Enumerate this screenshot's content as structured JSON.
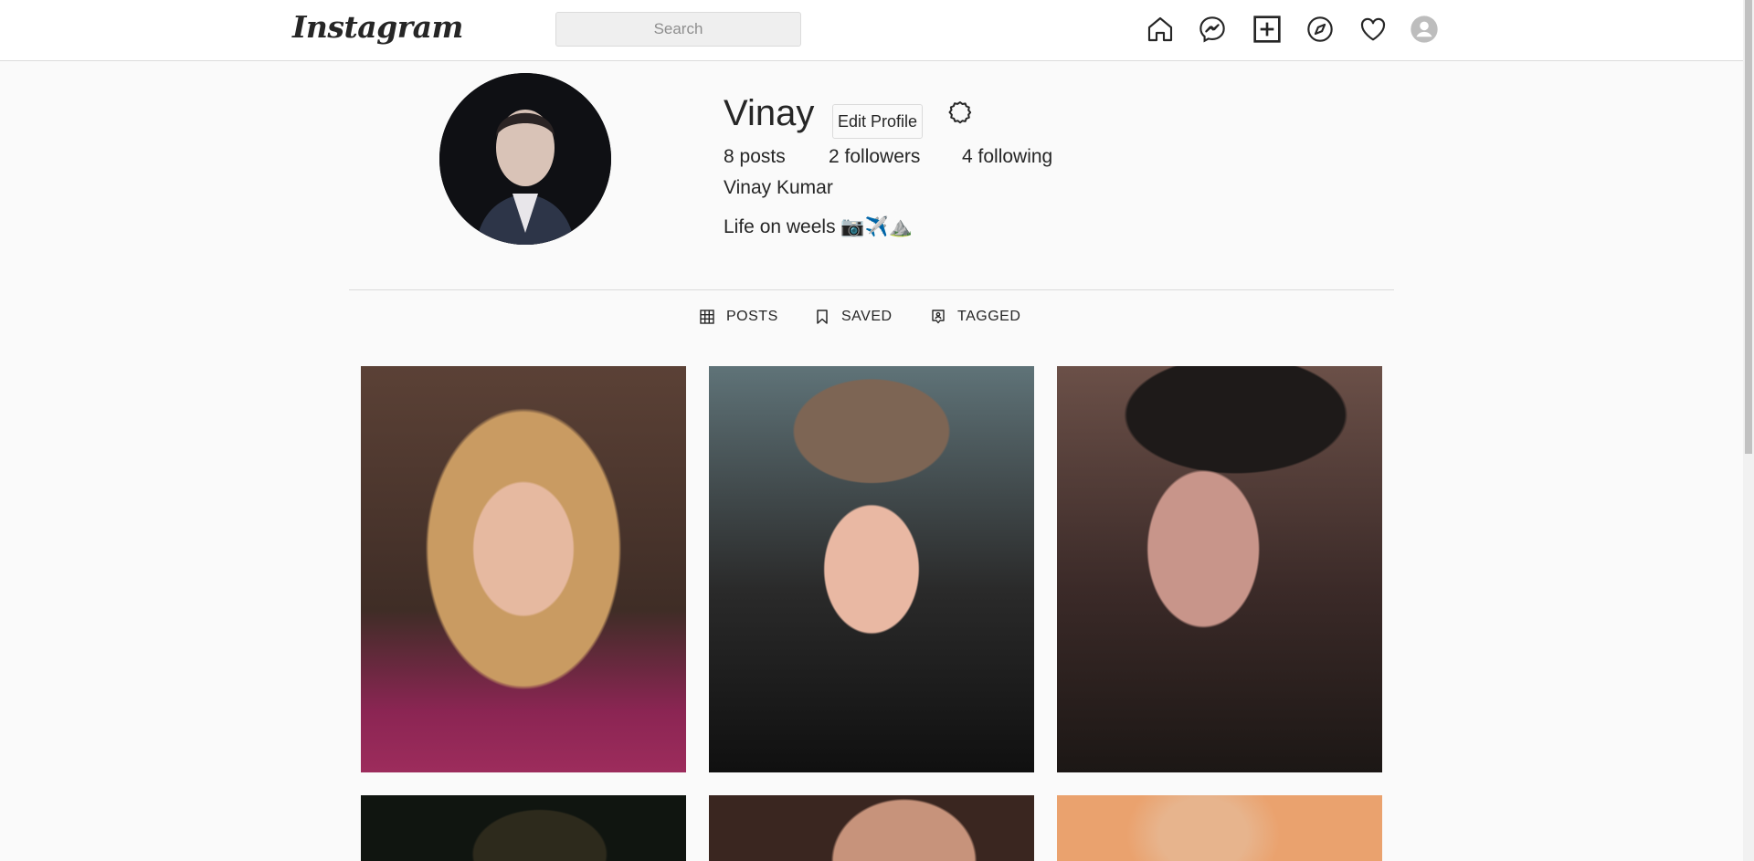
{
  "header": {
    "logo": "Instagram",
    "search_placeholder": "Search",
    "nav_icons": [
      "home-icon",
      "messenger-icon",
      "new-post-icon",
      "explore-icon",
      "activity-heart-icon",
      "profile-avatar-icon"
    ]
  },
  "profile": {
    "username": "Vinay",
    "edit_label": "Edit Profile",
    "settings_icon": "settings-gear-icon",
    "posts": "8 posts",
    "followers": "2 followers",
    "following": "4 following",
    "full_name": "Vinay Kumar",
    "bio": "Life on weels 📷✈️⛰️"
  },
  "tabs": [
    {
      "label": "POSTS",
      "icon": "grid-icon"
    },
    {
      "label": "SAVED",
      "icon": "bookmark-icon"
    },
    {
      "label": "TAGGED",
      "icon": "tagged-icon"
    }
  ],
  "colors": {
    "background": "#fafafa",
    "border": "#dbdbdb",
    "text": "#262626"
  }
}
